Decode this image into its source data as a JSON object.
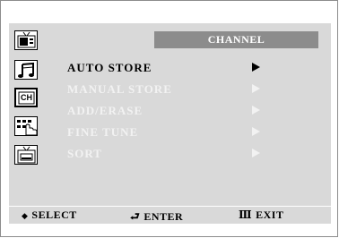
{
  "title": "CHANNEL",
  "menu": {
    "items": [
      {
        "label": "AUTO STORE",
        "selected": true
      },
      {
        "label": "MANUAL STORE",
        "selected": false
      },
      {
        "label": "ADD/ERASE",
        "selected": false
      },
      {
        "label": "FINE TUNE",
        "selected": false
      },
      {
        "label": "SORT",
        "selected": false
      }
    ]
  },
  "side_icons": [
    {
      "name": "picture-menu-icon"
    },
    {
      "name": "sound-menu-icon"
    },
    {
      "name": "channel-menu-icon",
      "text": "CH",
      "active": true
    },
    {
      "name": "setup-menu-icon"
    },
    {
      "name": "input-menu-icon"
    }
  ],
  "footer": {
    "select": {
      "symbol": "◆",
      "label": "SELECT"
    },
    "enter": {
      "symbol": "⮐",
      "label": "ENTER"
    },
    "exit": {
      "symbol": "Ⅲ",
      "label": "EXIT"
    }
  },
  "colors": {
    "panel": "#d9d9d9",
    "title_bar": "#8c8c8c",
    "selected_text": "#000000",
    "inactive_text": "#f2f2f2"
  }
}
